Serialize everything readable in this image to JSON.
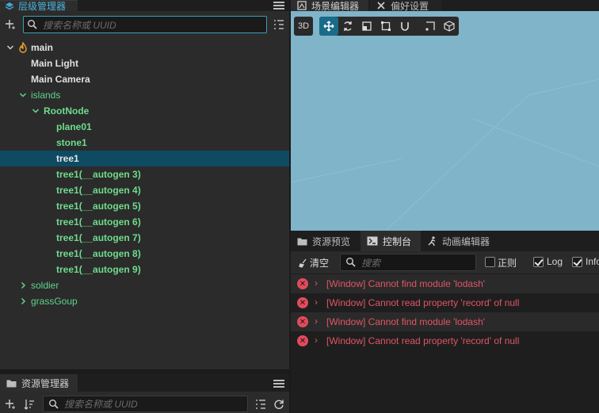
{
  "hierarchy": {
    "tab_label": "层级管理器",
    "search_placeholder": "搜索名称或 UUID",
    "nodes": [
      {
        "label": "main"
      },
      {
        "label": "Main Light"
      },
      {
        "label": "Main Camera"
      },
      {
        "label": "islands"
      },
      {
        "label": "RootNode"
      },
      {
        "label": "plane01"
      },
      {
        "label": "stone1"
      },
      {
        "label": "tree1"
      },
      {
        "label": "tree1(__autogen 3)"
      },
      {
        "label": "tree1(__autogen 4)"
      },
      {
        "label": "tree1(__autogen 5)"
      },
      {
        "label": "tree1(__autogen 6)"
      },
      {
        "label": "tree1(__autogen 7)"
      },
      {
        "label": "tree1(__autogen 8)"
      },
      {
        "label": "tree1(__autogen 9)"
      },
      {
        "label": "soldier"
      },
      {
        "label": "grassGoup"
      }
    ]
  },
  "assets": {
    "tab_label": "资源管理器",
    "search_placeholder": "搜索名称或 UUID"
  },
  "scene": {
    "tab_label": "场景编辑器",
    "prefs_tab_label": "偏好设置",
    "mode_label": "3D",
    "background_color": "#7fb4c9"
  },
  "console": {
    "tabs": [
      {
        "label": "资源预览"
      },
      {
        "label": "控制台"
      },
      {
        "label": "动画编辑器"
      }
    ],
    "clear_label": "清空",
    "search_placeholder": "搜索",
    "regex_label": "正则",
    "log_label": "Log",
    "info_label": "Info",
    "messages": [
      {
        "text": "[Window] Cannot find module 'lodash'"
      },
      {
        "text": "[Window] Cannot read property 'record' of null"
      },
      {
        "text": "[Window] Cannot find module 'lodash'"
      },
      {
        "text": "[Window] Cannot read property 'record' of null"
      }
    ]
  },
  "colors": {
    "accent": "#1a6a8a",
    "selected_row": "#0f4a63",
    "error": "#e05566",
    "node_green": "#5fd38a"
  }
}
